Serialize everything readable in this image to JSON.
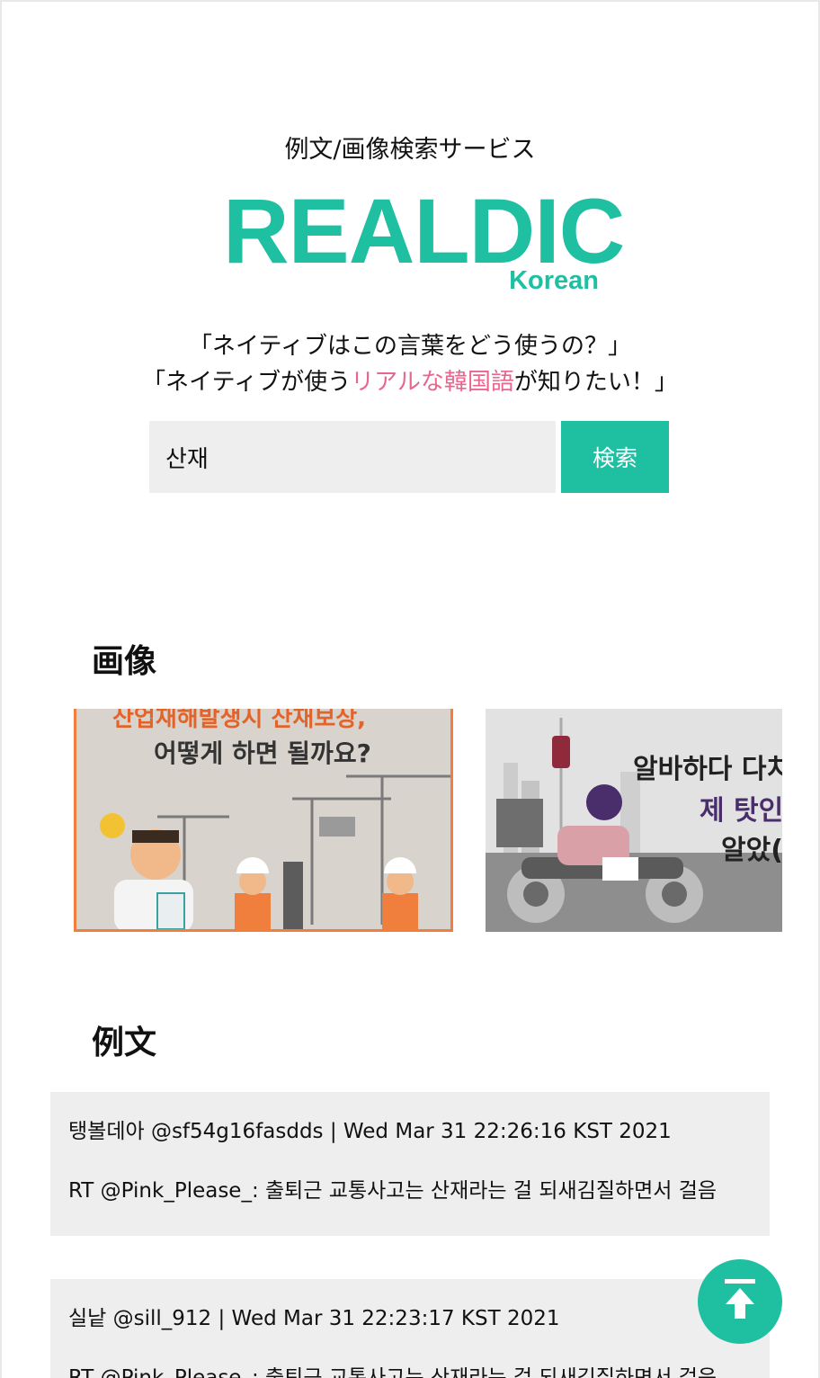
{
  "header": {
    "service_label": "例文/画像検索サービス",
    "logo_text": "REALDIC",
    "logo_sub": "Korean",
    "tagline1": "「ネイティブはこの言葉をどう使うの？」",
    "tagline2_pre": "「ネイティブが使う",
    "tagline2_highlight": "リアルな韓国語",
    "tagline2_post": "が知りたい！」"
  },
  "search": {
    "value": "산재",
    "button_label": "検索"
  },
  "images": {
    "title": "画像",
    "items": [
      {
        "line1": "산업재해발생시 산재보상,",
        "line2": "어떻게 하면 될까요?"
      },
      {
        "line1": "알바하다 다치",
        "line2": "제 탓인",
        "line3": "알았("
      }
    ]
  },
  "examples": {
    "title": "例文",
    "items": [
      {
        "meta": "탱볼데아 @sf54g16fasdds | Wed Mar 31 22:26:16 KST 2021",
        "body": "RT @Pink_Please_: 출퇴근 교통사고는 산재라는 걸 되새김질하면서 걸음"
      },
      {
        "meta": "실낱 @sill_912 | Wed Mar 31 22:23:17 KST 2021",
        "body": "RT @Pink_Please_: 출퇴근 교통사고는 산재라는 걸 되새김질하면서 걸음"
      }
    ]
  },
  "colors": {
    "accent": "#1fbfa2",
    "highlight": "#e9668f",
    "panel": "#eeeeee"
  },
  "icons": {
    "scroll_top": "arrow-up-bar-icon"
  }
}
